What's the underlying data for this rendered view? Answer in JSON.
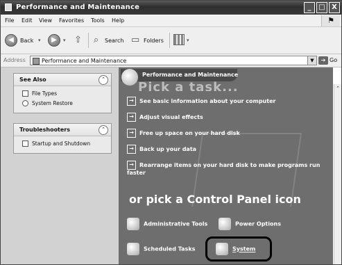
{
  "window": {
    "title": "Performance and Maintenance",
    "controls": {
      "minimize": "_",
      "maximize": "□",
      "close": "X"
    }
  },
  "menubar": {
    "items": [
      {
        "label": "File"
      },
      {
        "label": "Edit"
      },
      {
        "label": "View"
      },
      {
        "label": "Favorites"
      },
      {
        "label": "Tools"
      },
      {
        "label": "Help"
      }
    ]
  },
  "toolbar": {
    "back_label": "Back",
    "search_label": "Search",
    "folders_label": "Folders"
  },
  "address": {
    "label": "Address",
    "value": "Performance and Maintenance",
    "go_label": "Go"
  },
  "sidebar": {
    "see_also": {
      "title": "See Also",
      "items": [
        {
          "label": "File Types"
        },
        {
          "label": "System Restore"
        }
      ]
    },
    "troubleshooters": {
      "title": "Troubleshooters",
      "items": [
        {
          "label": "Startup and Shutdown"
        }
      ]
    }
  },
  "main": {
    "header_title": "Performance and Maintenance",
    "header_ghost": "Pick a task...",
    "tasks": [
      {
        "label": "See basic information about your computer"
      },
      {
        "label": "Adjust visual effects"
      },
      {
        "label": "Free up space on your hard disk"
      },
      {
        "label": "Back up your data"
      },
      {
        "label": "Rearrange items on your hard disk to make programs run faster"
      }
    ],
    "pick_heading": "or pick a Control Panel icon",
    "icons": [
      {
        "label": "Administrative Tools"
      },
      {
        "label": "Power Options"
      },
      {
        "label": "Scheduled Tasks"
      },
      {
        "label": "System"
      }
    ]
  }
}
